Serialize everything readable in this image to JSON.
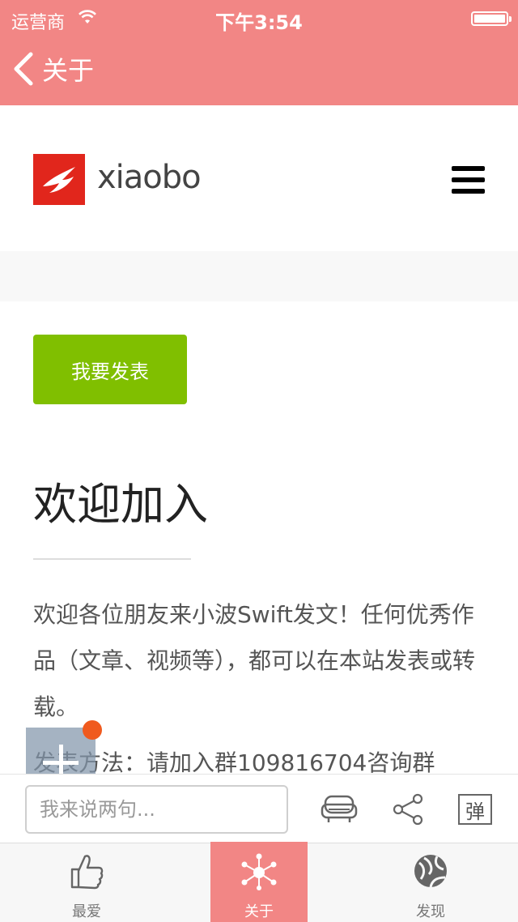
{
  "status_bar": {
    "carrier": "运营商",
    "time": "下午3:54"
  },
  "nav": {
    "back_label": "关于"
  },
  "site": {
    "logo_text": "xiaobo",
    "publish_button": "我要发表",
    "heading": "欢迎加入",
    "paragraph": "欢迎各位朋友来小波Swift发文！任何优秀作品（文章、视频等），都可以在本站发表或转载。",
    "method_line": "发表方法：请加入群109816704咨询群"
  },
  "comment_bar": {
    "placeholder": "我来说两句...",
    "danmu_label": "弹"
  },
  "tabs": [
    {
      "label": "最爱",
      "icon": "thumbs-up-icon",
      "active": false
    },
    {
      "label": "关于",
      "icon": "hub-icon",
      "active": true
    },
    {
      "label": "发现",
      "icon": "globe-icon",
      "active": false
    }
  ],
  "colors": {
    "nav": "#f28685",
    "publish": "#80bf00",
    "logo": "#e1261c",
    "badge": "#f05a1e"
  }
}
